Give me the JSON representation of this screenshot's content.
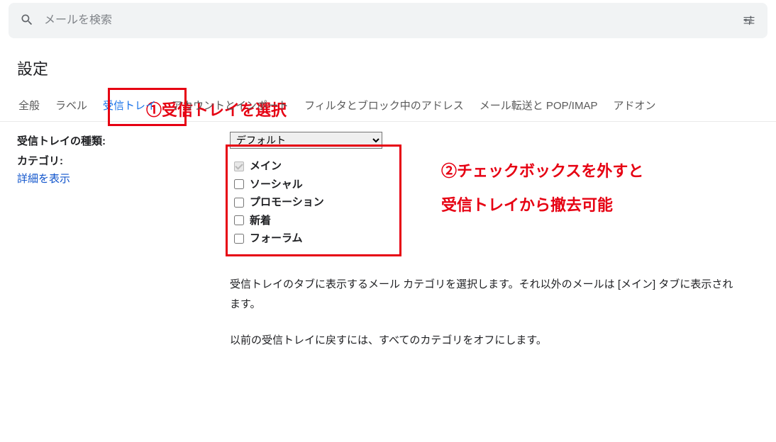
{
  "search": {
    "placeholder": "メールを検索"
  },
  "annotations": {
    "a1": "①受信トレイを選択",
    "a2_line1": "②チェックボックスを外すと",
    "a2_line2": "受信トレイから撤去可能"
  },
  "page_title": "設定",
  "tabs": {
    "general": "全般",
    "labels": "ラベル",
    "inbox": "受信トレイ",
    "accounts": "アカウントとインポート",
    "filters": "フィルタとブロック中のアドレス",
    "forwarding": "メール転送と POP/IMAP",
    "addons": "アドオン"
  },
  "inbox_type": {
    "label": "受信トレイの種類:",
    "selected": "デフォルト"
  },
  "categories": {
    "label": "カテゴリ:",
    "details_link": "詳細を表示",
    "items": {
      "main": "メイン",
      "social": "ソーシャル",
      "promotions": "プロモーション",
      "updates": "新着",
      "forums": "フォーラム"
    },
    "desc1": "受信トレイのタブに表示するメール カテゴリを選択します。それ以外のメールは [メイン] タブに表示されます。",
    "desc2": "以前の受信トレイに戻すには、すべてのカテゴリをオフにします。"
  }
}
